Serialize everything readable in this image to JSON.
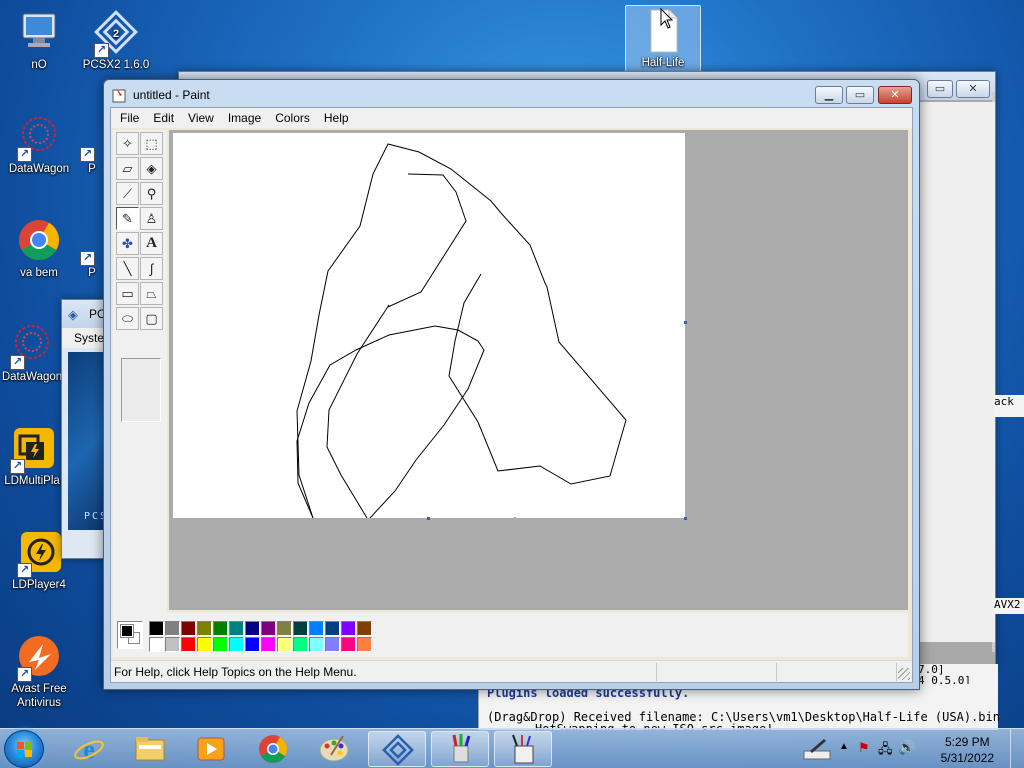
{
  "desktop": {
    "icons": [
      {
        "label": "nO"
      },
      {
        "label": "PCSX2 1.6.0"
      },
      {
        "label": "Half-Life"
      },
      {
        "label": "DataWagon"
      },
      {
        "label": "va bem"
      },
      {
        "label": "DataWagon"
      },
      {
        "label": "LDMultiPla"
      },
      {
        "label": "LDPlayer4"
      },
      {
        "label": "Avast Free Antivirus"
      }
    ],
    "partial_labels": {
      "p1": "P",
      "p2": "P"
    }
  },
  "pcsx2_window": {
    "title": "PC",
    "menu": "Syste",
    "logo_text": "PCSX"
  },
  "console_window": {
    "right_fragments": [
      "ack",
      "AVX2",
      "7.0]",
      "4 0.5.0]"
    ],
    "lines": [
      "Plugins loaded successfully.",
      "(Drag&Drop) Received filename: C:\\Users\\vm1\\Desktop\\Half-Life (USA).bin",
      "HotSwapping to new ISO src image!"
    ]
  },
  "paint": {
    "title": "untitled - Paint",
    "menu": [
      "File",
      "Edit",
      "View",
      "Image",
      "Colors",
      "Help"
    ],
    "status": "For Help, click Help Topics on the Help Menu.",
    "tools": [
      {
        "name": "free-form-select",
        "glyph": "✧"
      },
      {
        "name": "rect-select",
        "glyph": "⬚"
      },
      {
        "name": "eraser",
        "glyph": "▱"
      },
      {
        "name": "fill",
        "glyph": "◈"
      },
      {
        "name": "color-picker",
        "glyph": "⟋"
      },
      {
        "name": "magnifier",
        "glyph": "⚲"
      },
      {
        "name": "pencil",
        "glyph": "✎"
      },
      {
        "name": "brush",
        "glyph": "♙"
      },
      {
        "name": "airbrush",
        "glyph": "✤"
      },
      {
        "name": "text",
        "glyph": "A"
      },
      {
        "name": "line",
        "glyph": "╲"
      },
      {
        "name": "curve",
        "glyph": "∫"
      },
      {
        "name": "rectangle",
        "glyph": "▭"
      },
      {
        "name": "polygon",
        "glyph": "⏢"
      },
      {
        "name": "ellipse",
        "glyph": "⬭"
      },
      {
        "name": "rounded-rect",
        "glyph": "▢"
      }
    ],
    "palette_top": [
      "#000000",
      "#808080",
      "#800000",
      "#808000",
      "#008000",
      "#008080",
      "#000080",
      "#800080",
      "#808040",
      "#004040",
      "#0080ff",
      "#004080",
      "#8000ff",
      "#804000"
    ],
    "palette_bottom": [
      "#ffffff",
      "#c0c0c0",
      "#ff0000",
      "#ffff00",
      "#00ff00",
      "#00ffff",
      "#0000ff",
      "#ff00ff",
      "#ffff80",
      "#00ff80",
      "#80ffff",
      "#8080ff",
      "#ff0080",
      "#ff8040"
    ],
    "foreground": "#000000",
    "background": "#ffffff"
  },
  "taskbar": {
    "time": "5:29 PM",
    "date": "5/31/2022"
  }
}
